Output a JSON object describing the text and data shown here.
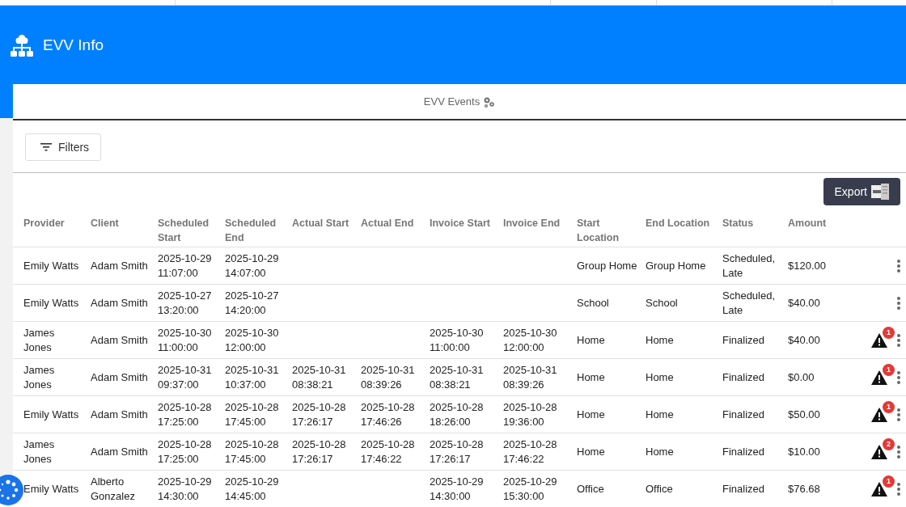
{
  "header": {
    "title": "EVV Info"
  },
  "tabs": [
    {
      "label": "EVV Events",
      "selected": true
    }
  ],
  "toolbar": {
    "filters_button": "Filters",
    "export_button": "Export"
  },
  "table": {
    "columns": [
      "Provider",
      "Client",
      "Scheduled Start",
      "Scheduled End",
      "Actual Start",
      "Actual End",
      "Invoice Start",
      "Invoice End",
      "Start Location",
      "End Location",
      "Status",
      "Amount"
    ],
    "rows": [
      {
        "cells": [
          [
            "Emily Watts"
          ],
          [
            "Adam Smith"
          ],
          [
            "2025-10-29",
            "11:07:00"
          ],
          [
            "2025-10-29",
            "14:07:00"
          ],
          [],
          [],
          [],
          [],
          [
            "Group Home"
          ],
          [
            "Group Home"
          ],
          [
            "Scheduled,",
            "Late"
          ],
          [
            "$120.00"
          ]
        ]
      },
      {
        "cells": [
          [
            "Emily Watts"
          ],
          [
            "Adam Smith"
          ],
          [
            "2025-10-27",
            "13:20:00"
          ],
          [
            "2025-10-27",
            "14:20:00"
          ],
          [],
          [],
          [],
          [],
          [
            "School"
          ],
          [
            "School"
          ],
          [
            "Scheduled,",
            "Late"
          ],
          [
            "$40.00"
          ]
        ]
      },
      {
        "cells": [
          [
            "James",
            "Jones"
          ],
          [
            "Adam Smith"
          ],
          [
            "2025-10-30",
            "11:00:00"
          ],
          [
            "2025-10-30",
            "12:00:00"
          ],
          [],
          [],
          [
            "2025-10-30",
            "11:00:00"
          ],
          [
            "2025-10-30",
            "12:00:00"
          ],
          [
            "Home"
          ],
          [
            "Home"
          ],
          [
            "Finalized"
          ],
          [
            "$40.00"
          ]
        ],
        "alert_count": "1"
      },
      {
        "cells": [
          [
            "James",
            "Jones"
          ],
          [
            "Adam Smith"
          ],
          [
            "2025-10-31",
            "09:37:00"
          ],
          [
            "2025-10-31",
            "10:37:00"
          ],
          [
            "2025-10-31",
            "08:38:21"
          ],
          [
            "2025-10-31",
            "08:39:26"
          ],
          [
            "2025-10-31",
            "08:38:21"
          ],
          [
            "2025-10-31",
            "08:39:26"
          ],
          [
            "Home"
          ],
          [
            "Home"
          ],
          [
            "Finalized"
          ],
          [
            "$0.00"
          ]
        ],
        "alert_count": "1"
      },
      {
        "cells": [
          [
            "Emily Watts"
          ],
          [
            "Adam Smith"
          ],
          [
            "2025-10-28",
            "17:25:00"
          ],
          [
            "2025-10-28",
            "17:45:00"
          ],
          [
            "2025-10-28",
            "17:26:17"
          ],
          [
            "2025-10-28",
            "17:46:26"
          ],
          [
            "2025-10-28",
            "18:26:00"
          ],
          [
            "2025-10-28",
            "19:36:00"
          ],
          [
            "Home"
          ],
          [
            "Home"
          ],
          [
            "Finalized"
          ],
          [
            "$50.00"
          ]
        ],
        "alert_count": "1"
      },
      {
        "cells": [
          [
            "James",
            "Jones"
          ],
          [
            "Adam Smith"
          ],
          [
            "2025-10-28",
            "17:25:00"
          ],
          [
            "2025-10-28",
            "17:45:00"
          ],
          [
            "2025-10-28",
            "17:26:17"
          ],
          [
            "2025-10-28",
            "17:46:22"
          ],
          [
            "2025-10-28",
            "17:26:17"
          ],
          [
            "2025-10-28",
            "17:46:22"
          ],
          [
            "Home"
          ],
          [
            "Home"
          ],
          [
            "Finalized"
          ],
          [
            "$10.00"
          ]
        ],
        "alert_count": "2"
      },
      {
        "cells": [
          [
            "Emily Watts"
          ],
          [
            "Alberto",
            "Gonzalez"
          ],
          [
            "2025-10-29",
            "14:30:00"
          ],
          [
            "2025-10-29",
            "14:45:00"
          ],
          [],
          [],
          [
            "2025-10-29",
            "14:30:00"
          ],
          [
            "2025-10-29",
            "15:30:00"
          ],
          [
            "Office"
          ],
          [
            "Office"
          ],
          [
            "Finalized"
          ],
          [
            "$76.68"
          ]
        ],
        "alert_count": "1"
      }
    ]
  }
}
